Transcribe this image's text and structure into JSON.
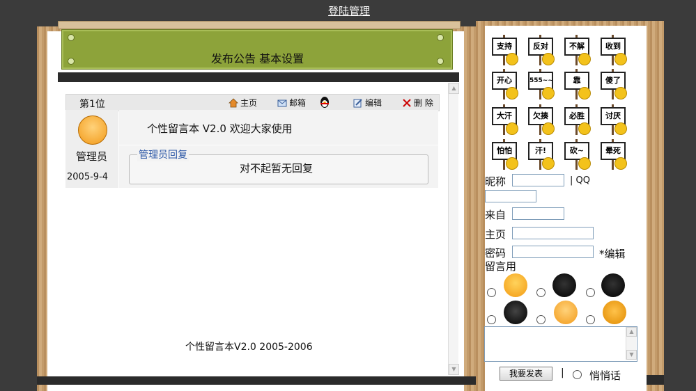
{
  "header": {
    "login_link": "登陆管理"
  },
  "banner": {
    "links": "发布公告 基本设置"
  },
  "post": {
    "rank": "第1位",
    "toolbar": {
      "home": "主页",
      "mail": "邮箱",
      "edit": "编辑",
      "delete": "删 除"
    },
    "author": "管理员",
    "date": "2005-9-4",
    "message": "个性留言本 V2.0 欢迎大家使用",
    "reply_title": "管理员回复",
    "reply_text": "对不起暂无回复"
  },
  "footer": {
    "text": "个性留言本V2.0 2005-2006"
  },
  "signs": [
    "支持",
    "反对",
    "不解",
    "收到",
    "开心",
    "555~~",
    "靠",
    "傻了",
    "大汗",
    "欠揍",
    "必胜",
    "讨厌",
    "怕怕",
    "汗!",
    "砍~",
    "晕死"
  ],
  "form": {
    "nickname_label": "昵称",
    "qq_label": "| QQ",
    "from_label": "来自",
    "homepage_label": "主页",
    "password_label": "密码",
    "edit_note": "*编辑",
    "edit_note2": "留言用",
    "submit_label": "我要发表",
    "separator": "|",
    "whisper_label": "悄悄话"
  },
  "colors": {
    "banner": "#8da33a",
    "board": "#c8a272",
    "background": "#3b3b3b"
  }
}
